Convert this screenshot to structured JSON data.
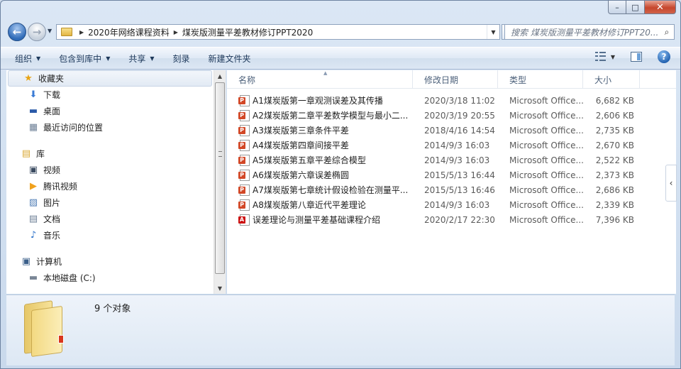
{
  "window": {
    "caption": {
      "minimize": "–",
      "maximize": "□",
      "close": "✕"
    }
  },
  "navigation": {
    "back_glyph": "←",
    "forward_glyph": "→",
    "recent_glyph": "▼",
    "breadcrumb": [
      "2020年网络课程资料",
      "煤炭版测量平差教材修订PPT2020"
    ],
    "separator": "▶",
    "dropdown_glyph": "▼",
    "refresh_glyph": "⟲",
    "search_placeholder": "搜索 煤炭版测量平差教材修订PPT20...",
    "search_glyph": "⌕"
  },
  "toolbar": {
    "items": [
      {
        "label": "组织",
        "dropdown": true
      },
      {
        "label": "包含到库中",
        "dropdown": true
      },
      {
        "label": "共享",
        "dropdown": true
      },
      {
        "label": "刻录",
        "dropdown": false
      },
      {
        "label": "新建文件夹",
        "dropdown": false
      }
    ],
    "caret": "▼",
    "help_glyph": "?"
  },
  "sidebar": {
    "favorites": {
      "label": "收藏夹",
      "icon": "star-icon",
      "glyph": "★",
      "color": "#e8a415"
    },
    "favorite_items": [
      {
        "label": "下载",
        "icon": "download-folder-icon",
        "glyph": "⬇",
        "color": "#3a7bd5"
      },
      {
        "label": "桌面",
        "icon": "desktop-icon",
        "glyph": "▬",
        "color": "#2a5aa8"
      },
      {
        "label": "最近访问的位置",
        "icon": "recent-places-icon",
        "glyph": "▦",
        "color": "#6d7f96"
      }
    ],
    "libraries": {
      "label": "库",
      "icon": "library-icon",
      "glyph": "▤",
      "color": "#d9a935"
    },
    "library_items": [
      {
        "label": "视频",
        "icon": "video-icon",
        "glyph": "▣",
        "color": "#3b4b61"
      },
      {
        "label": "腾讯视频",
        "icon": "tencent-video-icon",
        "glyph": "▶",
        "color": "#f0a11c"
      },
      {
        "label": "图片",
        "icon": "pictures-icon",
        "glyph": "▨",
        "color": "#4f7db5"
      },
      {
        "label": "文档",
        "icon": "documents-icon",
        "glyph": "▤",
        "color": "#6d7f96"
      },
      {
        "label": "音乐",
        "icon": "music-icon",
        "glyph": "♪",
        "color": "#2a6fc9"
      }
    ],
    "computer": {
      "label": "计算机",
      "icon": "computer-icon",
      "glyph": "▣",
      "color": "#3b5f8a"
    },
    "computer_items": [
      {
        "label": "本地磁盘 (C:)",
        "icon": "drive-icon",
        "glyph": "▬",
        "color": "#7a8696"
      }
    ],
    "scroll_up": "▲",
    "scroll_down": "▼"
  },
  "file_list": {
    "columns": {
      "name": "名称",
      "date": "修改日期",
      "type": "类型",
      "size": "大小"
    },
    "sort_glyph": "▲",
    "rows": [
      {
        "name": "A1煤炭版第一章观测误差及其传播",
        "date": "2020/3/18 11:02",
        "type": "Microsoft Office...",
        "size": "6,682 KB",
        "kind": "ppt"
      },
      {
        "name": "A2煤炭版第二章平差数学模型与最小二...",
        "date": "2020/3/19 20:55",
        "type": "Microsoft Office...",
        "size": "2,606 KB",
        "kind": "ppt"
      },
      {
        "name": "A3煤炭版第三章条件平差",
        "date": "2018/4/16 14:54",
        "type": "Microsoft Office...",
        "size": "2,735 KB",
        "kind": "ppt"
      },
      {
        "name": "A4煤炭版第四章间接平差",
        "date": "2014/9/3 16:03",
        "type": "Microsoft Office...",
        "size": "2,670 KB",
        "kind": "ppt"
      },
      {
        "name": "A5煤炭版第五章平差综合模型",
        "date": "2014/9/3 16:03",
        "type": "Microsoft Office...",
        "size": "2,522 KB",
        "kind": "ppt"
      },
      {
        "name": "A6煤炭版第六章误差椭圆",
        "date": "2015/5/13 16:44",
        "type": "Microsoft Office...",
        "size": "2,373 KB",
        "kind": "ppt"
      },
      {
        "name": "A7煤炭版第七章统计假设检验在测量平...",
        "date": "2015/5/13 16:46",
        "type": "Microsoft Office...",
        "size": "2,686 KB",
        "kind": "ppt"
      },
      {
        "name": "A8煤炭版第八章近代平差理论",
        "date": "2014/9/3 16:03",
        "type": "Microsoft Office...",
        "size": "2,339 KB",
        "kind": "ppt"
      },
      {
        "name": "误差理论与测量平差基础课程介绍",
        "date": "2020/2/17 22:30",
        "type": "Microsoft Office...",
        "size": "7,396 KB",
        "kind": "pdf"
      }
    ],
    "collapse_glyph": "‹"
  },
  "details": {
    "item_count": "9 个对象"
  }
}
